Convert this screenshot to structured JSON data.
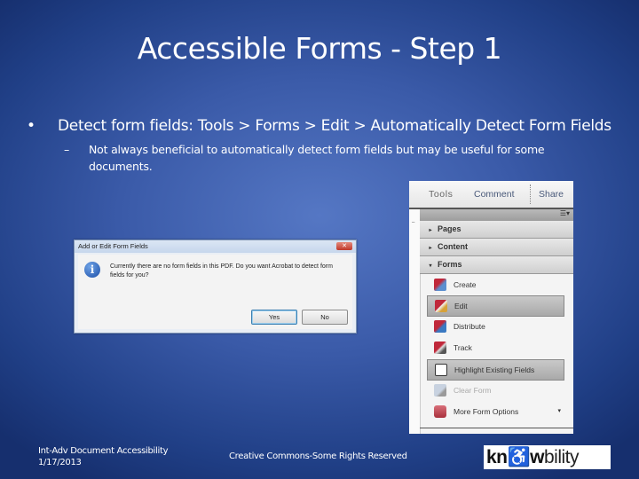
{
  "slide": {
    "title": "Accessible Forms - Step 1",
    "bullet": "Detect form fields: Tools > Forms > Edit > Automatically Detect Form Fields",
    "sub_dash": "–",
    "sub_bullet": "Not always beneficial to automatically detect form fields but may be useful for some documents."
  },
  "dialog": {
    "title": "Add or Edit Form Fields",
    "close_glyph": "✕",
    "info_glyph": "i",
    "message": "Currently there are no form fields in this PDF. Do you want Acrobat to detect form fields for you?",
    "yes_label": "Yes",
    "no_label": "No"
  },
  "panel": {
    "tabs": [
      "Tools",
      "Comment",
      "Share"
    ],
    "options_glyph": "☰▾",
    "sections": [
      {
        "label": "Pages",
        "arrow": "▸"
      },
      {
        "label": "Content",
        "arrow": "▸"
      },
      {
        "label": "Forms",
        "arrow": "▾"
      }
    ],
    "items": [
      {
        "label": "Create",
        "icon": "form-create-icon",
        "state": "normal"
      },
      {
        "label": "Edit",
        "icon": "form-edit-icon",
        "state": "selected"
      },
      {
        "label": "Distribute",
        "icon": "form-distribute-icon",
        "state": "normal"
      },
      {
        "label": "Track",
        "icon": "form-track-icon",
        "state": "normal"
      },
      {
        "label": "Highlight Existing Fields",
        "icon": "highlight-fields-icon",
        "state": "selected"
      },
      {
        "label": "Clear Form",
        "icon": "clear-form-icon",
        "state": "disabled"
      },
      {
        "label": "More Form Options",
        "icon": "toolbox-icon",
        "state": "normal",
        "dropdown": "▾"
      }
    ]
  },
  "footer": {
    "course": "Int-Adv Document Accessibility",
    "date": "1/17/2013",
    "license": "Creative Commons-Some Rights Reserved",
    "logo_bold": "kn",
    "logo_mid": "♿w",
    "logo_rest": "bility"
  }
}
